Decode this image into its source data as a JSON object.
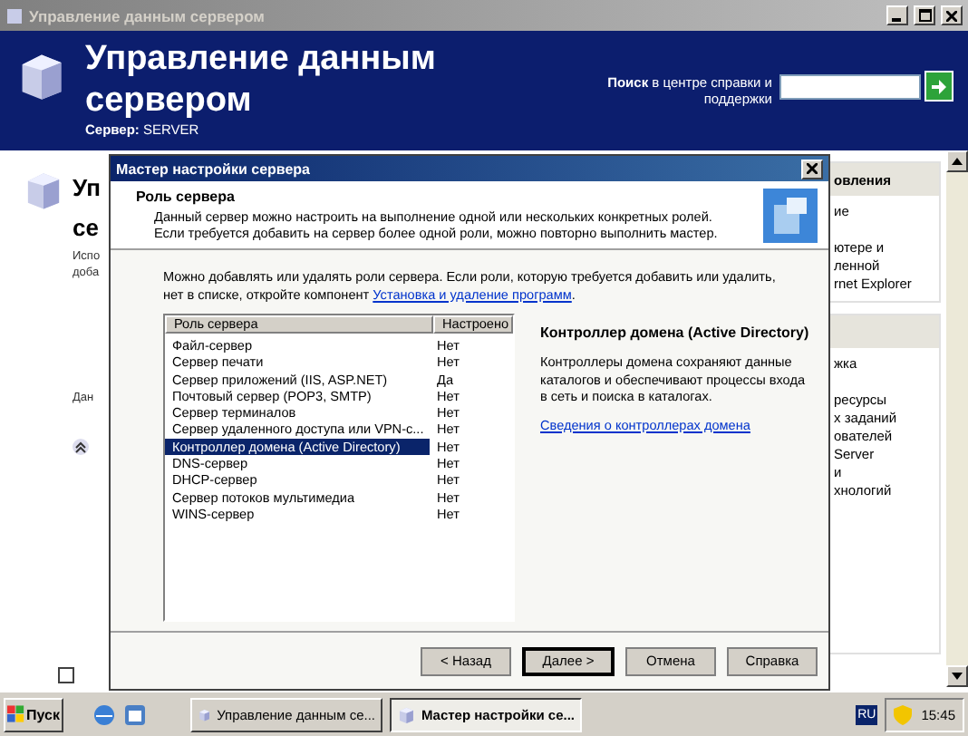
{
  "window": {
    "title": "Управление данным сервером",
    "active": false
  },
  "header": {
    "title": "Управление данным сервером",
    "server": "**Сервер:** SERVER",
    "search": {
      "label": "**Поиск** в центре справки и поддержки"
    }
  },
  "background": {
    "heading_lines": [
      "Уп",
      "се"
    ],
    "text_lines": [
      "Испо",
      "доба"
    ],
    "section": "Дан",
    "checkbox": {
      "checked": false
    },
    "right_panel": [
      {
        "header": "овления",
        "lines": [
          "ие",
          "ютере и",
          "ленной",
          "rnet Explorer"
        ]
      },
      {
        "lines": [
          "жка",
          "ресурсы",
          "х заданий",
          "ователей",
          "Server",
          "и",
          "хнологий"
        ]
      }
    ]
  },
  "dialog": {
    "title": "Мастер настройки сервера",
    "heading": "Роль сервера",
    "description": [
      "Данный сервер можно настроить на выполнение одной или нескольких конкретных ролей.",
      "Если требуется добавить на сервер более одной роли, можно повторно выполнить мастер."
    ],
    "intro": {
      "lines": [
        "Можно добавлять или удалять роли сервера. Если роли, которую требуется добавить или удалить,",
        "нет в списке, откройте компонент "
      ],
      "link": "Установка и удаление программ",
      "end": "."
    },
    "columns": [
      "Роль сервера",
      "Настроено"
    ],
    "rows": [
      {
        "role": "Файл-сервер",
        "configured": "Нет",
        "selected": false
      },
      {
        "role": "Сервер печати",
        "configured": "Нет",
        "selected": false
      },
      {
        "role": "Сервер приложений (IIS, ASP.NET)",
        "configured": "Да",
        "selected": false
      },
      {
        "role": "Почтовый сервер (POP3, SMTP)",
        "configured": "Нет",
        "selected": false
      },
      {
        "role": "Сервер терминалов",
        "configured": "Нет",
        "selected": false
      },
      {
        "role": "Сервер удаленного доступа или VPN-с...",
        "configured": "Нет",
        "selected": false
      },
      {
        "role": "Контроллер домена (Active Directory)",
        "configured": "Нет",
        "selected": true
      },
      {
        "role": "DNS-сервер",
        "configured": "Нет",
        "selected": false
      },
      {
        "role": "DHCP-сервер",
        "configured": "Нет",
        "selected": false
      },
      {
        "role": "Сервер потоков мультимедиа",
        "configured": "Нет",
        "selected": false
      },
      {
        "role": "WINS-сервер",
        "configured": "Нет",
        "selected": false
      }
    ],
    "details": {
      "title": "Контроллер домена (Active Directory)",
      "text": "Контроллеры домена сохраняют данные каталогов и обеспечивают процессы входа в сеть и поиска в каталогах.",
      "link": "Сведения о контроллерах домена"
    },
    "buttons": [
      {
        "label": "< Назад",
        "default": false
      },
      {
        "label": "Далее >",
        "default": true
      },
      {
        "label": "Отмена",
        "default": false
      },
      {
        "label": "Справка",
        "default": false
      }
    ]
  },
  "taskbar": {
    "start": "Пуск",
    "tasks": [
      {
        "label": "Управление данным се...",
        "active": false
      },
      {
        "label": "Мастер настройки се...",
        "active": true
      }
    ],
    "language": "RU",
    "clock": "15:45"
  }
}
